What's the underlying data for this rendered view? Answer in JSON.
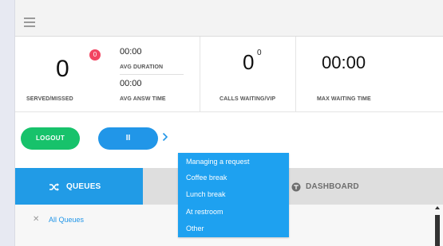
{
  "topbar": {
    "menu_icon": "hamburger-icon"
  },
  "stats": {
    "served": {
      "value": "0",
      "badge": "0",
      "label": "SERVED/MISSED"
    },
    "avg_duration": {
      "value": "00:00",
      "label": "AVG DURATION"
    },
    "avg_answer": {
      "value": "00:00",
      "label": "AVG ANSW TIME"
    },
    "calls_waiting": {
      "value": "0",
      "vip": "0",
      "label": "CALLS WAITING/VIP"
    },
    "max_waiting": {
      "value": "00:00",
      "label": "MAX WAITING TIME"
    }
  },
  "actions": {
    "logout_label": "LOGOUT",
    "pause_label": "II",
    "chevron_icon": "chevron-right-icon"
  },
  "pause_menu": {
    "items": [
      "Managing a request",
      "Coffee break",
      "Lunch break",
      "At restroom",
      "Other"
    ]
  },
  "tabs": {
    "queues": {
      "label": "QUEUES",
      "icon": "shuffle-icon"
    },
    "dashboard": {
      "label": "DASHBOARD",
      "icon": "dashboard-icon"
    }
  },
  "filter": {
    "clear_icon": "close-icon",
    "label": "All Queues"
  },
  "colors": {
    "green": "#17c26b",
    "blue": "#2196e8",
    "menu_blue": "#1ea1f0",
    "badge_red": "#f24461",
    "tab_active": "#219be6",
    "tab_inactive": "#dedede"
  }
}
